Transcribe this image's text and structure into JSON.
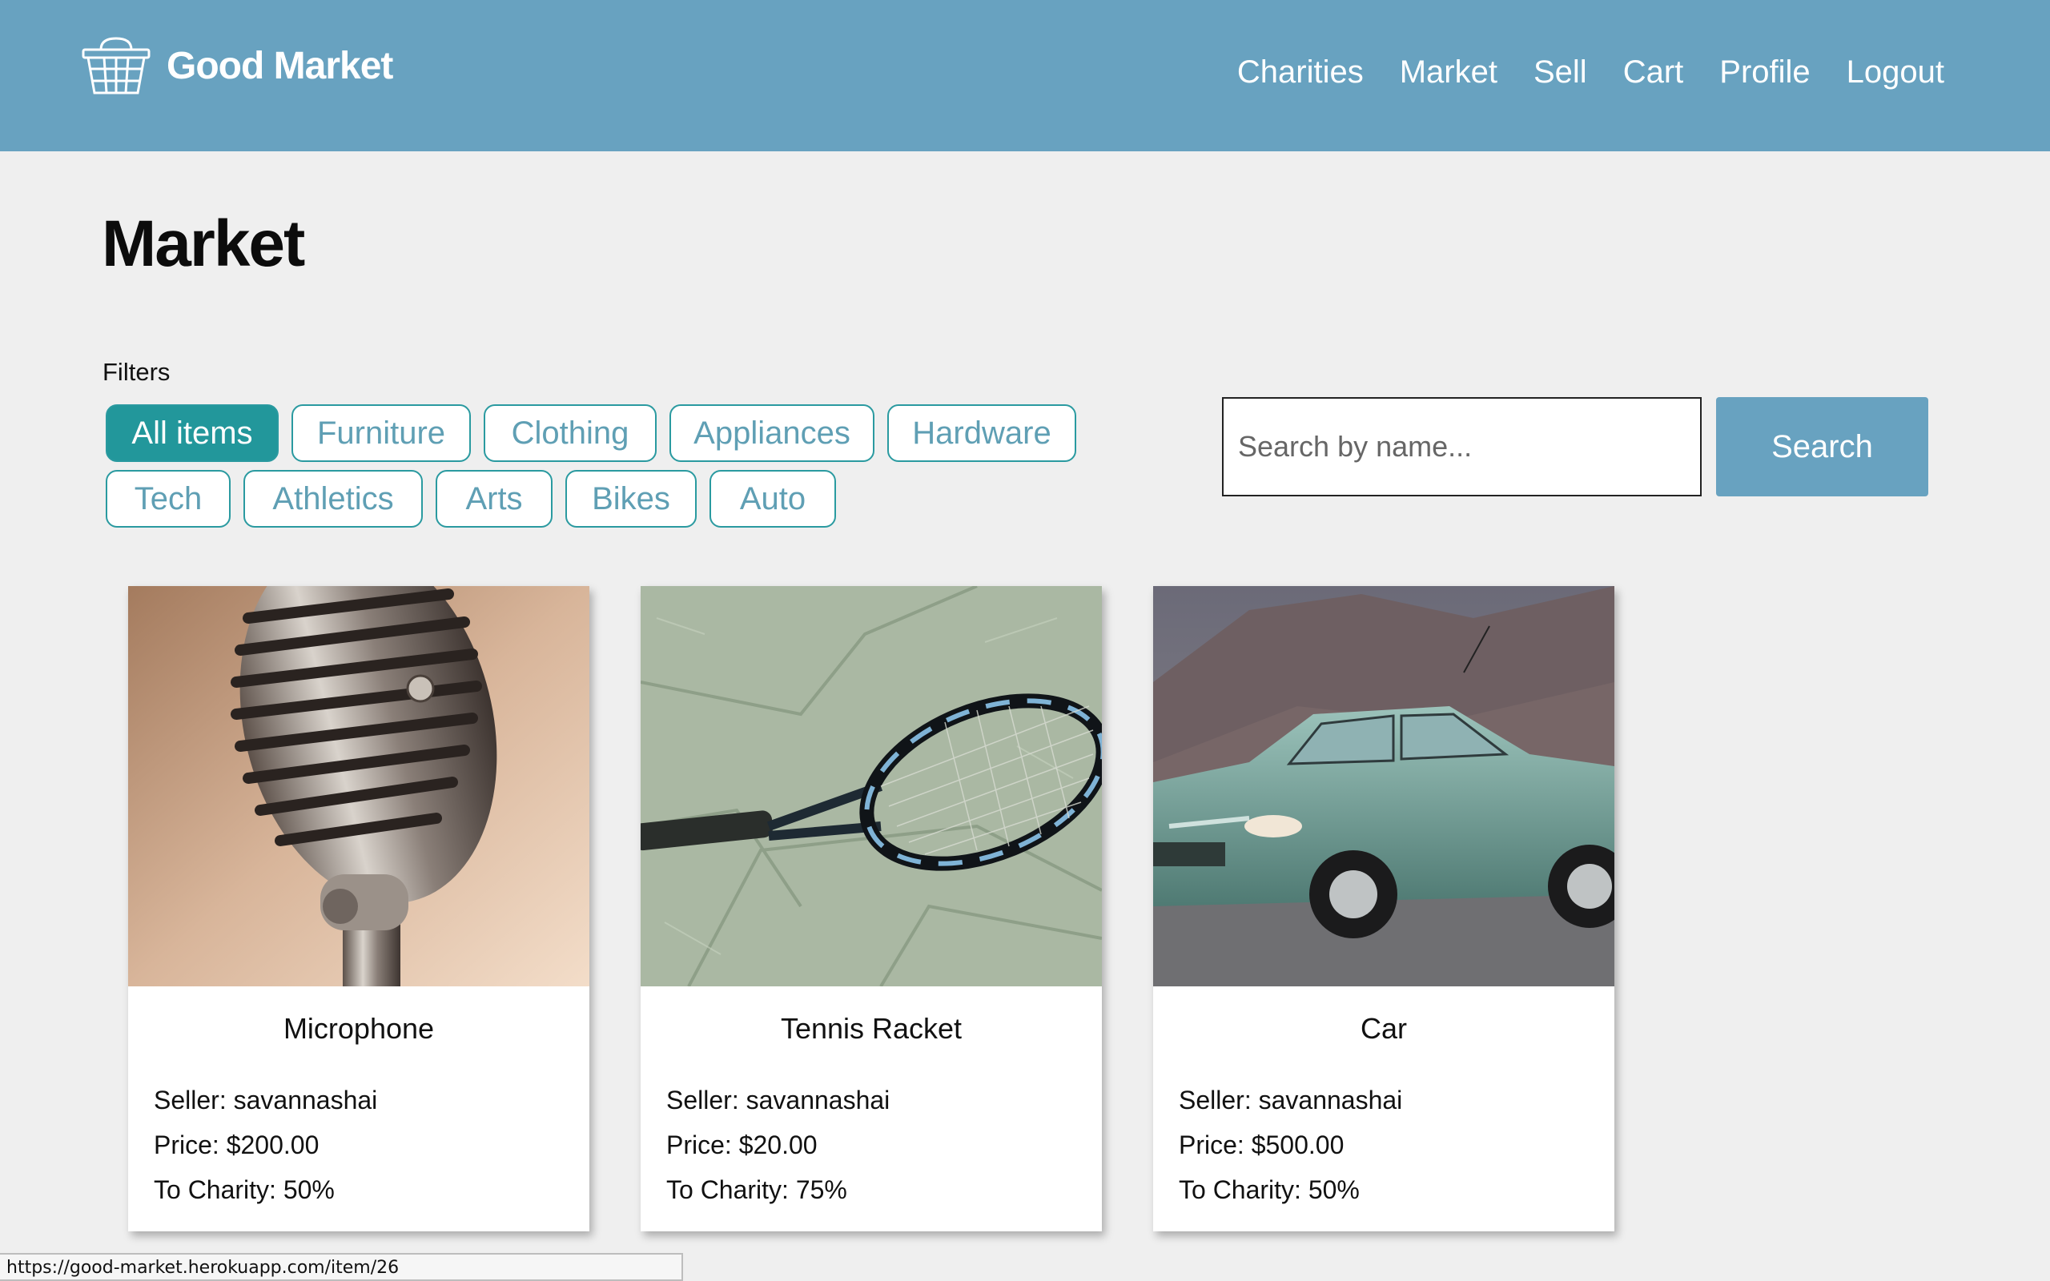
{
  "nav": {
    "brand": "Good Market",
    "links": [
      "Charities",
      "Market",
      "Sell",
      "Cart",
      "Profile",
      "Logout"
    ]
  },
  "page": {
    "title": "Market"
  },
  "filters": {
    "label": "Filters",
    "active": "All items",
    "rows": [
      [
        "All items",
        "Furniture",
        "Clothing",
        "Appliances",
        "Hardware"
      ],
      [
        "Tech",
        "Athletics",
        "Arts",
        "Bikes",
        "Auto"
      ]
    ]
  },
  "search": {
    "placeholder": "Search by name...",
    "value": "",
    "button_label": "Search"
  },
  "items": [
    {
      "title": "Microphone",
      "seller": "Seller: savannashai",
      "price": "Price: $200.00",
      "charity": "To Charity: 50%",
      "image": "microphone-photo"
    },
    {
      "title": "Tennis Racket",
      "seller": "Seller: savannashai",
      "price": "Price: $20.00",
      "charity": "To Charity: 75%",
      "image": "tennis-racket-photo"
    },
    {
      "title": "Car",
      "seller": "Seller: savannashai",
      "price": "Price: $500.00",
      "charity": "To Charity: 50%",
      "image": "car-photo"
    }
  ],
  "status_bar": {
    "url": "https://good-market.herokuapp.com/item/26"
  },
  "colors": {
    "nav_bg": "#68a2c0",
    "accent": "#22979b",
    "chip_text": "#5f9fb4",
    "page_bg": "#efefef"
  }
}
